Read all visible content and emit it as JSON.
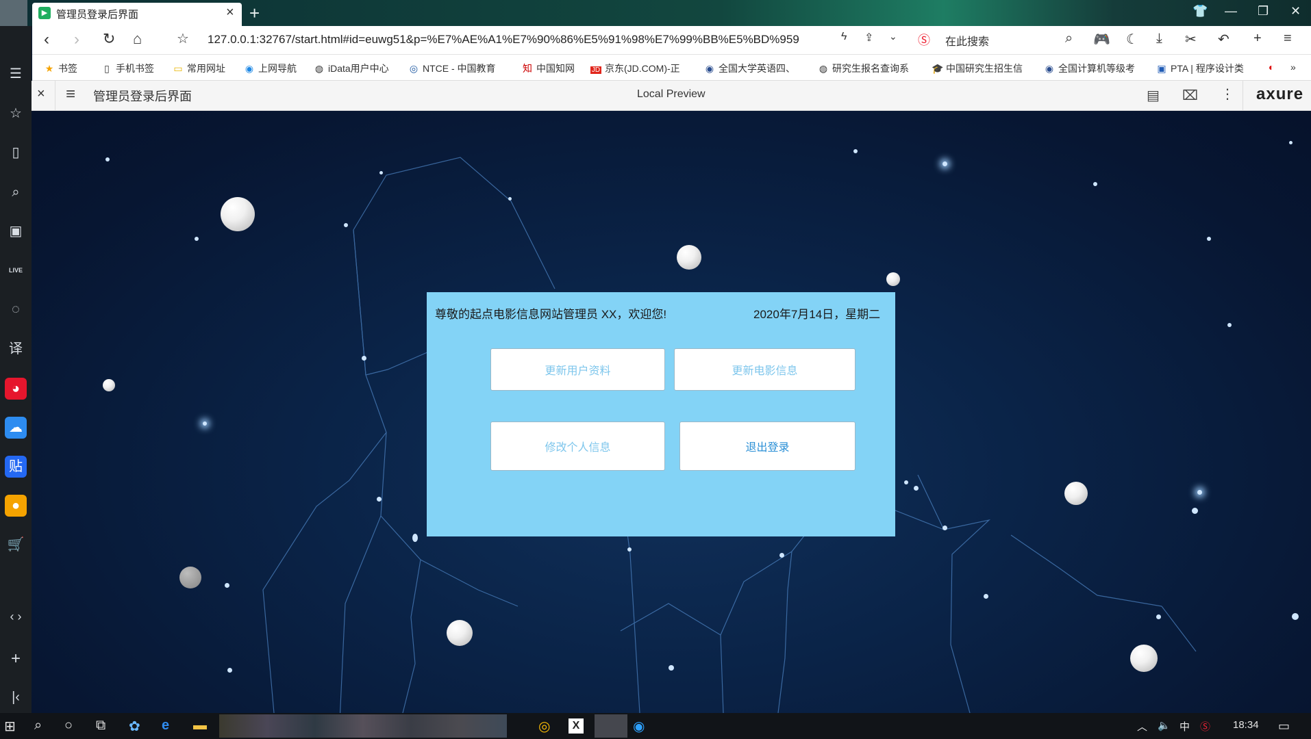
{
  "browser": {
    "tab_title": "管理员登录后界面",
    "url": "127.0.0.1:32767/start.html#id=euwg51&p=%E7%AE%A1%E7%90%86%E5%91%98%E7%99%BB%E5%BD%959",
    "search_placeholder": "在此搜索",
    "bookmarks": [
      "书签",
      "手机书签",
      "常用网址",
      "上网导航",
      "iData用户中心",
      "NTCE - 中国教育",
      "中国知网",
      "京东(JD.COM)-正",
      "全国大学英语四、",
      "研究生报名查询系",
      "中国研究生招生信",
      "全国计算机等级考",
      "PTA | 程序设计类"
    ]
  },
  "axure": {
    "page_title": "管理员登录后界面",
    "preview_label": "Local Preview",
    "logo": "axure"
  },
  "panel": {
    "welcome": "尊敬的起点电影信息网站管理员  XX，欢迎您!",
    "date": "2020年7月14日，星期二",
    "buttons": {
      "update_users": "更新用户资料",
      "update_movies": "更新电影信息",
      "edit_profile": "修改个人信息",
      "logout": "退出登录"
    },
    "bg_color": "#83d3f6"
  },
  "taskbar": {
    "ime": "中",
    "time": "18:34"
  }
}
